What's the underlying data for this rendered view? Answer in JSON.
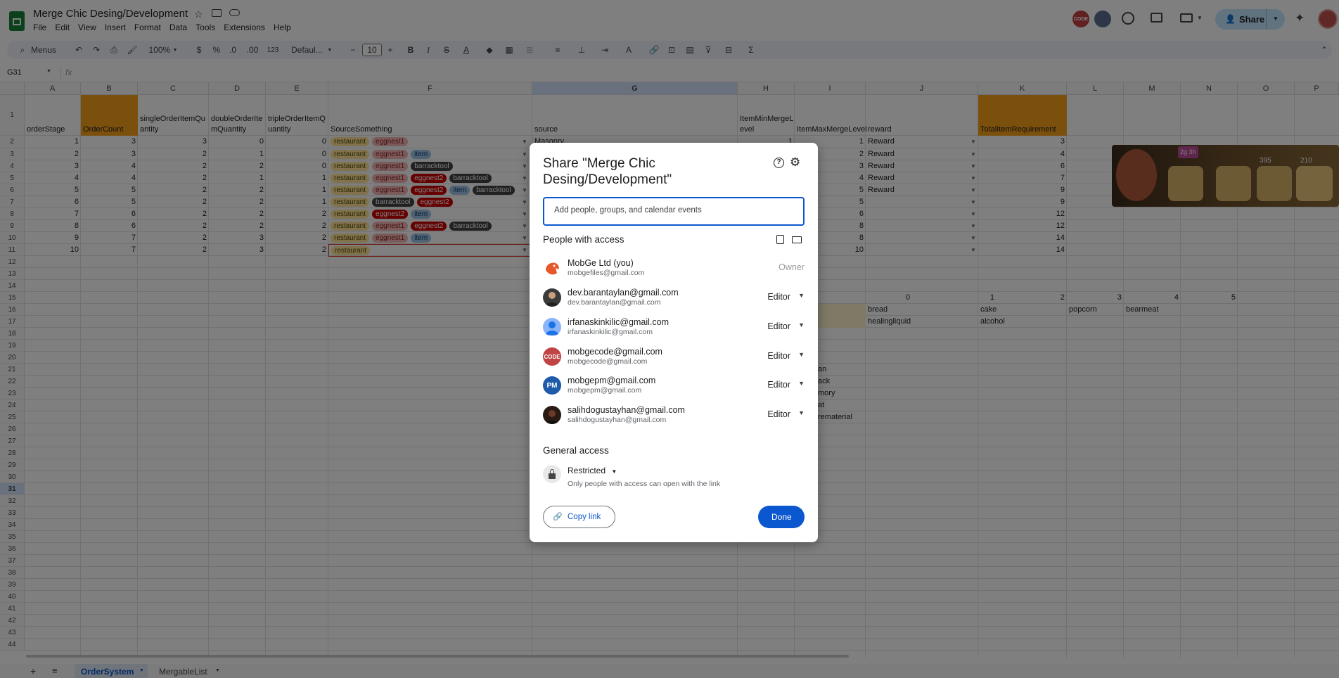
{
  "app": {
    "doc_title": "Merge Chic Desing/Development",
    "menus": [
      "File",
      "Edit",
      "View",
      "Insert",
      "Format",
      "Data",
      "Tools",
      "Extensions",
      "Help"
    ],
    "share_label": "Share"
  },
  "toolbar": {
    "search": "Menus",
    "zoom": "100%",
    "currency": "$",
    "percent": "%",
    "dec_less": ".0",
    "dec_more": ".00",
    "format_123": "123",
    "font": "Defaul...",
    "font_size": "10"
  },
  "formula_bar": {
    "cell_ref": "G31",
    "fx": "fx"
  },
  "columns": [
    "A",
    "B",
    "C",
    "D",
    "E",
    "F",
    "G",
    "H",
    "I",
    "J",
    "K",
    "L",
    "M",
    "N",
    "O",
    "P"
  ],
  "rows": [
    "1",
    "2",
    "3",
    "4",
    "5",
    "6",
    "7",
    "8",
    "9",
    "10",
    "11",
    "12",
    "13",
    "14",
    "15",
    "16",
    "17",
    "18",
    "19",
    "20",
    "21",
    "22",
    "23",
    "24",
    "25",
    "26",
    "27",
    "28",
    "29",
    "30",
    "31",
    "32",
    "33",
    "34",
    "35",
    "36",
    "37",
    "38",
    "39",
    "40",
    "41",
    "42",
    "43",
    "44"
  ],
  "headers": {
    "a": "orderStage",
    "b": "OrderCount",
    "c1": "singleOrderItemQu",
    "c2": "antity",
    "d1": "doubleOrderIte",
    "d2": "mQuantity",
    "e1": "tripleOrderItemQ",
    "e2": "uantity",
    "f": "SourceSomething",
    "g": "source",
    "h1": "ItemMinMergeL",
    "h2": "evel",
    "i": "ItemMaxMergeLevel",
    "j": "reward",
    "k": "TotalItemRequirement"
  },
  "data_rows": [
    {
      "a": "1",
      "b": "3",
      "c": "3",
      "d": "0",
      "e": "0",
      "chips": [
        {
          "t": "restaurant",
          "k": "y"
        },
        {
          "t": "eggnest1",
          "k": "r"
        }
      ],
      "g": "Masonry",
      "h": "1",
      "i": "1",
      "j": "Reward",
      "k": "3"
    },
    {
      "a": "2",
      "b": "3",
      "c": "2",
      "d": "1",
      "e": "0",
      "chips": [
        {
          "t": "restaurant",
          "k": "y"
        },
        {
          "t": "eggnest1",
          "k": "r"
        },
        {
          "t": "item",
          "k": "b"
        }
      ],
      "g": "",
      "h": "",
      "i": "2",
      "j": "Reward",
      "k": "4"
    },
    {
      "a": "3",
      "b": "4",
      "c": "2",
      "d": "2",
      "e": "0",
      "chips": [
        {
          "t": "restaurant",
          "k": "y"
        },
        {
          "t": "eggnest1",
          "k": "r"
        },
        {
          "t": "barracktool",
          "k": "d"
        }
      ],
      "g": "",
      "h": "",
      "i": "3",
      "j": "Reward",
      "k": "6"
    },
    {
      "a": "4",
      "b": "4",
      "c": "2",
      "d": "1",
      "e": "1",
      "chips": [
        {
          "t": "restaurant",
          "k": "y"
        },
        {
          "t": "eggnest1",
          "k": "r"
        },
        {
          "t": "eggnest2",
          "k": "R"
        },
        {
          "t": "barracktool",
          "k": "d"
        }
      ],
      "g": "",
      "h": "",
      "i": "4",
      "j": "Reward",
      "k": "7"
    },
    {
      "a": "5",
      "b": "5",
      "c": "2",
      "d": "2",
      "e": "1",
      "chips": [
        {
          "t": "restaurant",
          "k": "y"
        },
        {
          "t": "eggnest1",
          "k": "r"
        },
        {
          "t": "eggnest2",
          "k": "R"
        },
        {
          "t": "item",
          "k": "b"
        },
        {
          "t": "barracktool",
          "k": "d"
        }
      ],
      "g": "",
      "h": "",
      "i": "5",
      "j": "Reward",
      "k": "9"
    },
    {
      "a": "6",
      "b": "5",
      "c": "2",
      "d": "2",
      "e": "1",
      "chips": [
        {
          "t": "restaurant",
          "k": "y"
        },
        {
          "t": "barracktool",
          "k": "d"
        },
        {
          "t": "eggnest2",
          "k": "R"
        }
      ],
      "g": "",
      "h": "",
      "i": "5",
      "j": "",
      "k": "9"
    },
    {
      "a": "7",
      "b": "6",
      "c": "2",
      "d": "2",
      "e": "2",
      "chips": [
        {
          "t": "restaurant",
          "k": "y"
        },
        {
          "t": "eggnest2",
          "k": "R"
        },
        {
          "t": "item",
          "k": "b"
        }
      ],
      "g": "",
      "h": "",
      "i": "6",
      "j": "",
      "k": "12"
    },
    {
      "a": "8",
      "b": "6",
      "c": "2",
      "d": "2",
      "e": "2",
      "chips": [
        {
          "t": "restaurant",
          "k": "y"
        },
        {
          "t": "eggnest1",
          "k": "r"
        },
        {
          "t": "eggnest2",
          "k": "R"
        },
        {
          "t": "barracktool",
          "k": "d"
        }
      ],
      "g": "",
      "h": "",
      "i": "8",
      "j": "",
      "k": "12"
    },
    {
      "a": "9",
      "b": "7",
      "c": "2",
      "d": "3",
      "e": "2",
      "chips": [
        {
          "t": "restaurant",
          "k": "y"
        },
        {
          "t": "eggnest1",
          "k": "r"
        },
        {
          "t": "item",
          "k": "b"
        }
      ],
      "g": "",
      "h": "",
      "i": "8",
      "j": "",
      "k": "14"
    },
    {
      "a": "10",
      "b": "7",
      "c": "2",
      "d": "3",
      "e": "2",
      "chips": [
        {
          "t": "restaurant",
          "k": "y"
        }
      ],
      "g": "",
      "h": "",
      "i": "10",
      "j": "",
      "k": "14"
    }
  ],
  "lower": {
    "row15": [
      "0",
      "1",
      "2",
      "3",
      "4",
      "5"
    ],
    "r16": [
      "bread",
      "cake",
      "popcorn",
      "bearmeat"
    ],
    "r17": [
      "healingliquid",
      "alcohol"
    ],
    "i_frag": [
      "an",
      "ack",
      "mory",
      "at",
      "rematerial"
    ]
  },
  "game_overlay": {
    "badge": "2g 3h",
    "coins": "395",
    "gems": "210"
  },
  "dialog": {
    "title_line1": "Share \"Merge Chic",
    "title_line2": "Desing/Development\"",
    "add_placeholder": "Add people, groups, and calendar events",
    "people_heading": "People with access",
    "general_heading": "General access",
    "restricted": "Restricted",
    "restricted_desc": "Only people with access can open with the link",
    "copy_link": "Copy link",
    "done": "Done",
    "people": [
      {
        "name": "MobGe Ltd (you)",
        "email": "mobgefiles@gmail.com",
        "role": "Owner",
        "avatar": "orange",
        "initials": ""
      },
      {
        "name": "dev.barantaylan@gmail.com",
        "email": "dev.barantaylan@gmail.com",
        "role": "Editor",
        "avatar": "photo",
        "initials": ""
      },
      {
        "name": "irfanaskinkilic@gmail.com",
        "email": "irfanaskinkilic@gmail.com",
        "role": "Editor",
        "avatar": "generic",
        "initials": ""
      },
      {
        "name": "mobgecode@gmail.com",
        "email": "mobgecode@gmail.com",
        "role": "Editor",
        "avatar": "code",
        "initials": "CODE"
      },
      {
        "name": "mobgepm@gmail.com",
        "email": "mobgepm@gmail.com",
        "role": "Editor",
        "avatar": "pm",
        "initials": "PM"
      },
      {
        "name": "salihdogustayhan@gmail.com",
        "email": "salihdogustayhan@gmail.com",
        "role": "Editor",
        "avatar": "dark",
        "initials": ""
      }
    ]
  },
  "sheet_tabs": [
    {
      "label": "OrderSystem"
    },
    {
      "label": "MergableList"
    }
  ],
  "colors": {
    "orange_header": "#f6a01a",
    "chip_yellow": "#ffe599",
    "chip_red": "#e06666",
    "chip_dark_red": "#cc0000",
    "chip_blue": "#9fc5e8",
    "chip_dark": "#434343",
    "done_blue": "#0b57d0"
  }
}
